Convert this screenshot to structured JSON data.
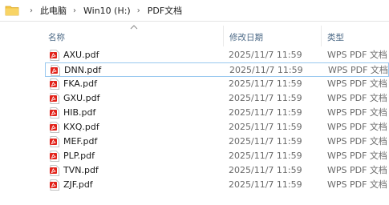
{
  "breadcrumb": {
    "items": [
      "此电脑",
      "Win10 (H:)",
      "PDF文档"
    ],
    "separator": "›"
  },
  "columns": {
    "name": "名称",
    "date": "修改日期",
    "type": "类型"
  },
  "files": [
    {
      "name": "AXU.pdf",
      "date": "2025/11/7 11:59",
      "type": "WPS PDF 文档"
    },
    {
      "name": "DNN.pdf",
      "date": "2025/11/7 11:59",
      "type": "WPS PDF 文档"
    },
    {
      "name": "FKA.pdf",
      "date": "2025/11/7 11:59",
      "type": "WPS PDF 文档"
    },
    {
      "name": "GXU.pdf",
      "date": "2025/11/7 11:59",
      "type": "WPS PDF 文档"
    },
    {
      "name": "HIB.pdf",
      "date": "2025/11/7 11:59",
      "type": "WPS PDF 文档"
    },
    {
      "name": "KXQ.pdf",
      "date": "2025/11/7 11:59",
      "type": "WPS PDF 文档"
    },
    {
      "name": "MEF.pdf",
      "date": "2025/11/7 11:59",
      "type": "WPS PDF 文档"
    },
    {
      "name": "PLP.pdf",
      "date": "2025/11/7 11:59",
      "type": "WPS PDF 文档"
    },
    {
      "name": "TVN.pdf",
      "date": "2025/11/7 11:59",
      "type": "WPS PDF 文档"
    },
    {
      "name": "ZJF.pdf",
      "date": "2025/11/7 11:59",
      "type": "WPS PDF 文档"
    }
  ],
  "focused_file": "DNN.pdf",
  "colors": {
    "pdf_icon": "#e2231a",
    "folder": "#f4c542",
    "header_text": "#4d6a87",
    "focus_border": "#99c8ef"
  }
}
